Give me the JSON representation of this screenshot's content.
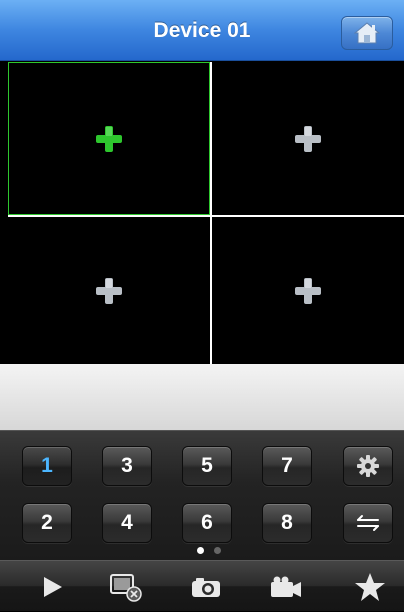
{
  "header": {
    "title": "Device 01",
    "home_icon": "home-icon"
  },
  "grid": {
    "cells": [
      {
        "icon": "add-icon",
        "selected": true
      },
      {
        "icon": "add-icon",
        "selected": false
      },
      {
        "icon": "add-icon",
        "selected": false
      },
      {
        "icon": "add-icon",
        "selected": false
      }
    ]
  },
  "keypad": {
    "row1": [
      "1",
      "3",
      "5",
      "7"
    ],
    "row2": [
      "2",
      "4",
      "6",
      "8"
    ],
    "settings_icon": "gear-icon",
    "swap_icon": "swap-arrows-icon"
  },
  "pager": {
    "total": 2,
    "current": 1
  },
  "toolbar": {
    "icons": [
      "play-icon",
      "close-window-icon",
      "camera-icon",
      "video-camera-icon",
      "star-icon"
    ]
  },
  "colors": {
    "header_blue": "#3e86e0",
    "selected_green": "#2ec72e",
    "active_key_blue": "#4cb6ff",
    "plus_gray": "#b9bfc6"
  }
}
